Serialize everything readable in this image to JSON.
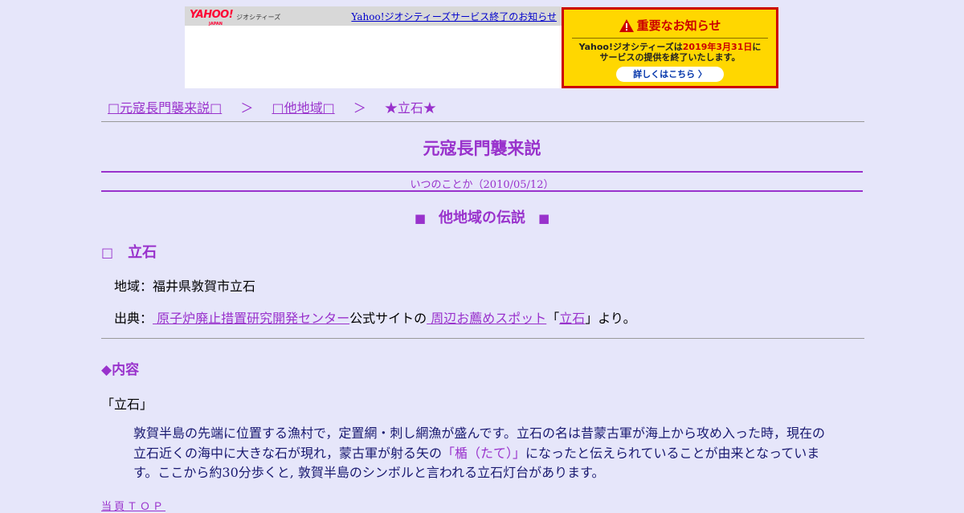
{
  "banner": {
    "yahoo_logo": "YAHOO!",
    "yahoo_logo_sub": "JAPAN",
    "geo_label": "ジオシティーズ",
    "notice_link": "Yahoo!ジオシティーズサービス終了のお知らせ",
    "notice_title": "重要なお知らせ",
    "notice_body_1": "Yahoo!ジオシティーズは",
    "notice_body_date": "2019年3月31日",
    "notice_body_2": "に",
    "notice_body_3": "サービスの提供を終了いたします。",
    "notice_button": "詳しくはこちら 〉",
    "notice_bg": "#ffd700",
    "notice_border": "#cc0000"
  },
  "breadcrumb": {
    "item1": "□元寇長門襲来説□",
    "sep": "＞",
    "item2": "□他地域□",
    "current": "★立石★"
  },
  "page": {
    "title": "元寇長門襲来説",
    "subtitle": "いつのことか（2010/05/12）",
    "section_marker": "■",
    "section_title": "他地域の伝説",
    "item_marker": "□",
    "item_title": "立石",
    "region_label": "地域：",
    "region_value": "福井県敦賀市立石",
    "source_label": "出典：",
    "source_link1": " 原子炉廃止措置研究開発センター",
    "source_mid": "公式サイトの",
    "source_link2": " 周辺お薦めスポット",
    "source_quote_open": "「",
    "source_link3": "立石",
    "source_quote_close": "」より。",
    "content_heading": "◆内容",
    "quote_label": "「立石」",
    "body_1": "敦賀半島の先端に位置する漁村で，定置網・刺し網漁が盛んです。立石の名は昔蒙古軍が海上から攻め入った時，現在の立石近くの海中に大きな石が現れ，蒙古軍が射る矢の",
    "body_highlight": "「楯（たて）」",
    "body_2": "になったと伝えられていることが由来となっています。ここから約30分歩くと, 敦賀半島のシンボルと言われる立石灯台があります。",
    "top_link": "当頁ＴＯＰ"
  },
  "colors": {
    "background": "#e6e6fa",
    "accent": "#9932cc",
    "body_text": "#191970"
  }
}
